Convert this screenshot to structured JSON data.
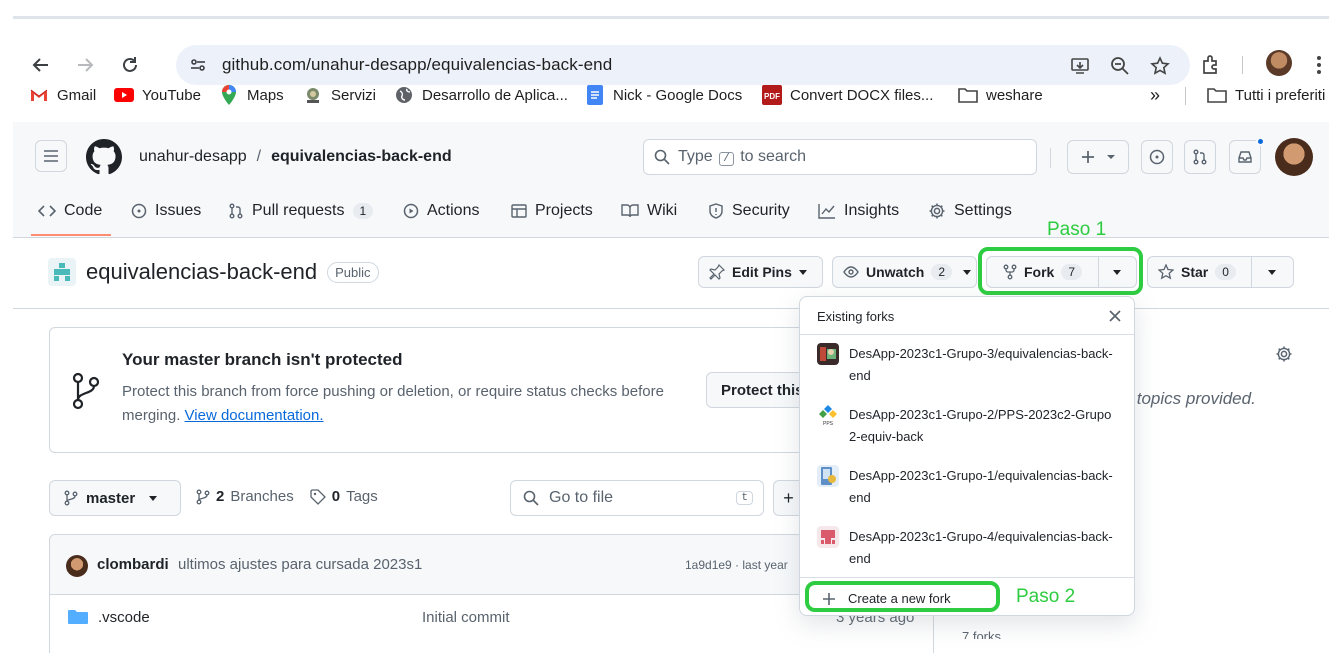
{
  "browser": {
    "url": "github.com/unahur-desapp/equivalencias-back-end",
    "bookmarks": [
      {
        "label": "Gmail",
        "icon": "gmail-icon"
      },
      {
        "label": "YouTube",
        "icon": "youtube-icon"
      },
      {
        "label": "Maps",
        "icon": "maps-icon"
      },
      {
        "label": "Servizi",
        "icon": "servizi-icon"
      },
      {
        "label": "Desarrollo de Aplica...",
        "icon": "globe-icon"
      },
      {
        "label": "Nick - Google Docs",
        "icon": "docs-icon"
      },
      {
        "label": "Convert DOCX files...",
        "icon": "pdf-icon"
      },
      {
        "label": "weshare",
        "icon": "folder-icon"
      }
    ],
    "overflow": "»",
    "all_bookmarks": "Tutti i preferiti"
  },
  "github": {
    "owner": "unahur-desapp",
    "separator": "/",
    "repo": "equivalencias-back-end",
    "search_text": "Type",
    "search_key": "/",
    "search_suffix": "to search",
    "tabs": [
      {
        "label": "Code",
        "icon": "code-icon"
      },
      {
        "label": "Issues",
        "icon": "issue-icon"
      },
      {
        "label": "Pull requests",
        "icon": "pull-request-icon",
        "count": "1"
      },
      {
        "label": "Actions",
        "icon": "play-icon"
      },
      {
        "label": "Projects",
        "icon": "table-icon"
      },
      {
        "label": "Wiki",
        "icon": "book-icon"
      },
      {
        "label": "Security",
        "icon": "shield-icon"
      },
      {
        "label": "Insights",
        "icon": "graph-icon"
      },
      {
        "label": "Settings",
        "icon": "gear-icon"
      }
    ]
  },
  "repo_header": {
    "name": "equivalencias-back-end",
    "visibility": "Public",
    "edit_pins": "Edit Pins",
    "unwatch": "Unwatch",
    "watch_count": "2",
    "fork": "Fork",
    "fork_count": "7",
    "star": "Star",
    "star_count": "0"
  },
  "annotations": {
    "paso1": "Paso 1",
    "paso2": "Paso 2",
    "highlight_color": "#2ecc40"
  },
  "banner": {
    "title": "Your master branch isn't protected",
    "description": "Protect this branch from force pushing or deletion, or require status checks before merging.",
    "link": "View documentation.",
    "button": "Protect this"
  },
  "file_nav": {
    "branch": "master",
    "branches_count": "2",
    "branches_label": "Branches",
    "tags_count": "0",
    "tags_label": "Tags",
    "go_to_file": "Go to file",
    "go_key": "t",
    "add_icon": "+"
  },
  "commit": {
    "author": "clombardi",
    "message": "ultimos ajustes para cursada 2023s1",
    "hash_time": "1a9d1e9 · last year"
  },
  "files": [
    {
      "name": ".vscode",
      "message": "Initial commit",
      "time": "3 years ago"
    }
  ],
  "about": {
    "text": "e, or topics provided.",
    "forks_partial": "7 forks"
  },
  "fork_menu": {
    "title": "Existing forks",
    "forks": [
      {
        "name": "DesApp-2023c1-Grupo-3/equivalencias-back-end"
      },
      {
        "name": "DesApp-2023c1-Grupo-2/PPS-2023c2-Grupo2-equiv-back"
      },
      {
        "name": "DesApp-2023c1-Grupo-1/equivalencias-back-end"
      },
      {
        "name": "DesApp-2023c1-Grupo-4/equivalencias-back-end"
      }
    ],
    "create": "Create a new fork"
  }
}
